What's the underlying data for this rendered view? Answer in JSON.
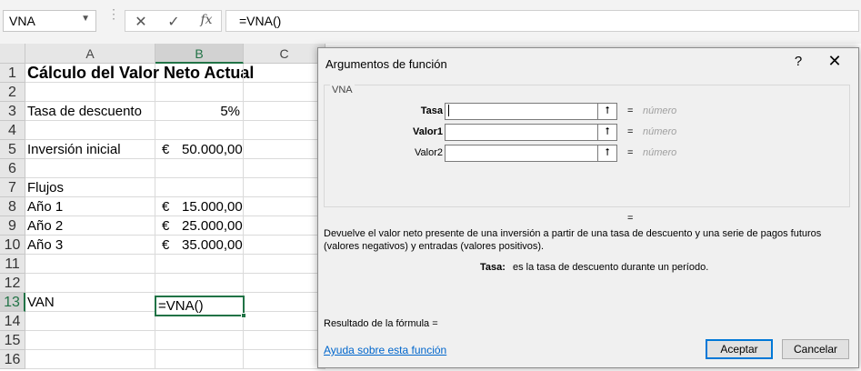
{
  "formula_bar": {
    "name_box": "VNA",
    "cancel_glyph": "✕",
    "enter_glyph": "✓",
    "fx_glyph": "fx",
    "formula": "=VNA()"
  },
  "columns": [
    "A",
    "B",
    "C"
  ],
  "rows": [
    {
      "num": "1",
      "a": "Cálculo del Valor Neto Actual",
      "b": ""
    },
    {
      "num": "2",
      "a": "",
      "b": ""
    },
    {
      "num": "3",
      "a": "Tasa de descuento",
      "b": "5%"
    },
    {
      "num": "4",
      "a": "",
      "b": ""
    },
    {
      "num": "5",
      "a": "Inversión inicial",
      "b_sym": "€",
      "b": "50.000,00"
    },
    {
      "num": "6",
      "a": "",
      "b": ""
    },
    {
      "num": "7",
      "a": "Flujos",
      "b": ""
    },
    {
      "num": "8",
      "a": "Año 1",
      "b_sym": "€",
      "b": "15.000,00"
    },
    {
      "num": "9",
      "a": "Año 2",
      "b_sym": "€",
      "b": "25.000,00"
    },
    {
      "num": "10",
      "a": "Año 3",
      "b_sym": "€",
      "b": "35.000,00"
    },
    {
      "num": "11",
      "a": "",
      "b": ""
    },
    {
      "num": "12",
      "a": "",
      "b": ""
    },
    {
      "num": "13",
      "a": "VAN",
      "b": ""
    },
    {
      "num": "14",
      "a": "",
      "b": ""
    },
    {
      "num": "15",
      "a": "",
      "b": ""
    },
    {
      "num": "16",
      "a": "",
      "b": ""
    }
  ],
  "active_cell_value": "=VNA()",
  "dialog": {
    "title": "Argumentos de función",
    "help_glyph": "?",
    "close_glyph": "✕",
    "function_name": "VNA",
    "args": [
      {
        "label": "Tasa",
        "value": "",
        "eq": "=",
        "type": "número"
      },
      {
        "label": "Valor1",
        "value": "",
        "eq": "=",
        "type": "número"
      },
      {
        "label": "Valor2",
        "value": "",
        "eq": "=",
        "type": "número"
      }
    ],
    "collapse_glyph": "⭡",
    "result_eq": "=",
    "description": "Devuelve el valor neto presente de una inversión a partir de una tasa de descuento y una serie de pagos futuros (valores negativos) y entradas (valores positivos).",
    "param_name": "Tasa:",
    "param_desc": "es la tasa de descuento durante un período.",
    "result_label": "Resultado de la fórmula =",
    "help_link": "Ayuda sobre esta función",
    "ok_label": "Aceptar",
    "cancel_label": "Cancelar"
  }
}
